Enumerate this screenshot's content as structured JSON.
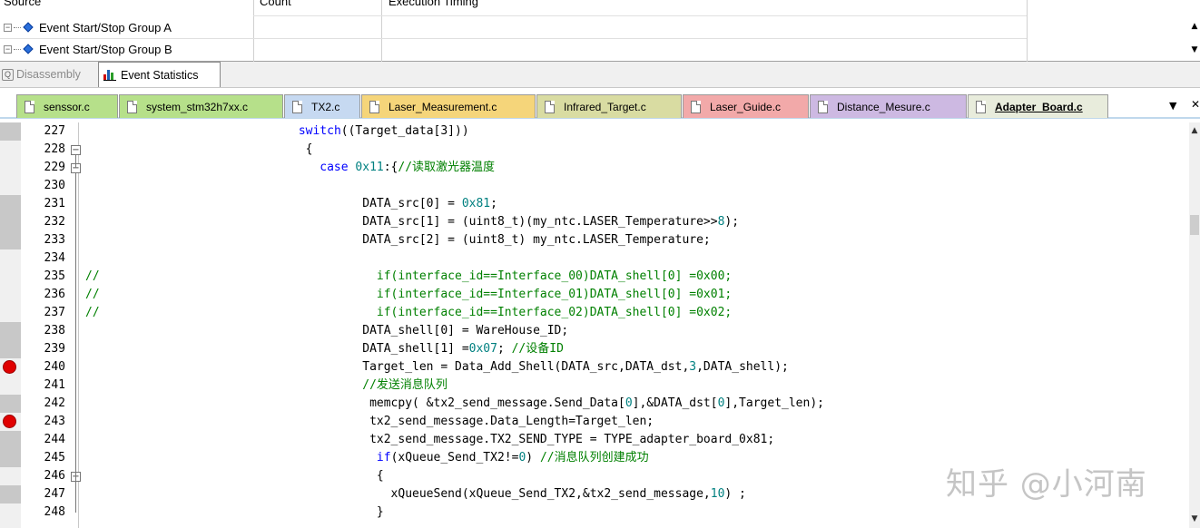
{
  "event_table": {
    "headers": [
      "Source",
      "Count",
      "Execution Timing"
    ],
    "groups": [
      "Event Start/Stop Group A",
      "Event Start/Stop Group B"
    ]
  },
  "bottom_tabs": [
    {
      "label": "Disassembly",
      "active": false
    },
    {
      "label": "Event Statistics",
      "active": true
    }
  ],
  "file_tabs": [
    {
      "label": "senssor.c",
      "color": "#b6e08a"
    },
    {
      "label": "system_stm32h7xx.c",
      "color": "#b6e08a"
    },
    {
      "label": "TX2.c",
      "color": "#c6d9f1"
    },
    {
      "label": "Laser_Measurement.c",
      "color": "#f5d57a"
    },
    {
      "label": "Infrared_Target.c",
      "color": "#d9dca2"
    },
    {
      "label": "Laser_Guide.c",
      "color": "#f2a9a9"
    },
    {
      "label": "Distance_Mesure.c",
      "color": "#cdb9e2"
    },
    {
      "label": "Adapter_Board.c",
      "color": "#e8ecdc",
      "active": true
    }
  ],
  "editor": {
    "lines": [
      {
        "n": "227",
        "mark": true,
        "tokens": [
          {
            "t": "                              "
          },
          {
            "t": "switch",
            "c": "kw"
          },
          {
            "t": "((Target_data[3]))"
          }
        ]
      },
      {
        "n": "228",
        "fold": true,
        "tokens": [
          {
            "t": "                               {"
          }
        ]
      },
      {
        "n": "229",
        "fold": true,
        "tokens": [
          {
            "t": "                                 "
          },
          {
            "t": "case",
            "c": "kw"
          },
          {
            "t": " "
          },
          {
            "t": "0x11",
            "c": "num"
          },
          {
            "t": ":{"
          },
          {
            "t": "//读取激光器温度",
            "c": "cm"
          }
        ]
      },
      {
        "n": "230",
        "tokens": []
      },
      {
        "n": "231",
        "mark": true,
        "tokens": [
          {
            "t": "                                       DATA_src[0] = "
          },
          {
            "t": "0x81",
            "c": "num"
          },
          {
            "t": ";"
          }
        ]
      },
      {
        "n": "232",
        "mark": true,
        "tokens": [
          {
            "t": "                                       DATA_src[1] = (uint8_t)(my_ntc.LASER_Temperature>>"
          },
          {
            "t": "8",
            "c": "num"
          },
          {
            "t": ");"
          }
        ]
      },
      {
        "n": "233",
        "mark": true,
        "tokens": [
          {
            "t": "                                       DATA_src[2] = (uint8_t) my_ntc.LASER_Temperature;"
          }
        ]
      },
      {
        "n": "234",
        "tokens": []
      },
      {
        "n": "235",
        "tokens": [
          {
            "t": "//                                       if(interface_id==Interface_00)DATA_shell[0] =0x00;",
            "c": "cm"
          }
        ]
      },
      {
        "n": "236",
        "tokens": [
          {
            "t": "//                                       if(interface_id==Interface_01)DATA_shell[0] =0x01;",
            "c": "cm"
          }
        ]
      },
      {
        "n": "237",
        "tokens": [
          {
            "t": "//                                       if(interface_id==Interface_02)DATA_shell[0] =0x02;",
            "c": "cm"
          }
        ]
      },
      {
        "n": "238",
        "mark": true,
        "tokens": [
          {
            "t": "                                       DATA_shell[0] = WareHouse_ID;"
          }
        ]
      },
      {
        "n": "239",
        "mark": true,
        "tokens": [
          {
            "t": "                                       DATA_shell[1] ="
          },
          {
            "t": "0x07",
            "c": "num"
          },
          {
            "t": "; "
          },
          {
            "t": "//设备ID",
            "c": "cm"
          }
        ]
      },
      {
        "n": "240",
        "breakpoint": true,
        "tokens": [
          {
            "t": "                                       Target_len = Data_Add_Shell(DATA_src,DATA_dst,"
          },
          {
            "t": "3",
            "c": "num"
          },
          {
            "t": ",DATA_shell);"
          }
        ]
      },
      {
        "n": "241",
        "tokens": [
          {
            "t": "                                       "
          },
          {
            "t": "//发送消息队列",
            "c": "cm"
          }
        ]
      },
      {
        "n": "242",
        "mark": true,
        "tokens": [
          {
            "t": "                                        memcpy( &tx2_send_message.Send_Data["
          },
          {
            "t": "0",
            "c": "num"
          },
          {
            "t": "],&DATA_dst["
          },
          {
            "t": "0",
            "c": "num"
          },
          {
            "t": "],Target_len);"
          }
        ]
      },
      {
        "n": "243",
        "breakpoint": true,
        "tokens": [
          {
            "t": "                                        tx2_send_message.Data_Length=Target_len;"
          }
        ]
      },
      {
        "n": "244",
        "mark": true,
        "tokens": [
          {
            "t": "                                        tx2_send_message.TX2_SEND_TYPE = TYPE_adapter_board_0x81;"
          }
        ]
      },
      {
        "n": "245",
        "mark": true,
        "tokens": [
          {
            "t": "                                         "
          },
          {
            "t": "if",
            "c": "kw"
          },
          {
            "t": "(xQueue_Send_TX2!="
          },
          {
            "t": "0",
            "c": "num"
          },
          {
            "t": ") "
          },
          {
            "t": "//消息队列创建成功",
            "c": "cm"
          }
        ]
      },
      {
        "n": "246",
        "fold": true,
        "tokens": [
          {
            "t": "                                         {"
          }
        ]
      },
      {
        "n": "247",
        "mark": true,
        "tokens": [
          {
            "t": "                                           xQueueSend(xQueue_Send_TX2,&tx2_send_message,"
          },
          {
            "t": "10",
            "c": "num"
          },
          {
            "t": ") ;"
          }
        ]
      },
      {
        "n": "248",
        "tokens": [
          {
            "t": "                                         }"
          }
        ]
      }
    ]
  },
  "watermark": "知乎 @小河南"
}
